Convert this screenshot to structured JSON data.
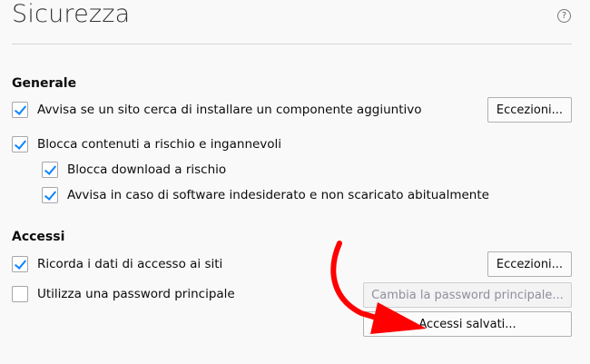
{
  "page": {
    "title": "Sicurezza",
    "help_icon": "?"
  },
  "general": {
    "heading": "Generale",
    "addons_warn_label": "Avvisa se un sito cerca di installare un componente aggiuntivo",
    "exceptions_label": "Eccezioni...",
    "block_dangerous_label": "Blocca contenuti a rischio e ingannevoli",
    "block_downloads_label": "Blocca download a rischio",
    "warn_unwanted_label": "Avvisa in caso di software indesiderato e non scaricato abitualmente"
  },
  "logins": {
    "heading": "Accessi",
    "remember_label": "Ricorda i dati di accesso ai siti",
    "exceptions_label": "Eccezioni...",
    "master_password_label": "Utilizza una password principale",
    "change_master_label": "Cambia la password principale...",
    "saved_logins_label": "Accessi salvati..."
  },
  "colors": {
    "accent": "#0a84ff",
    "annotation_arrow": "#ff0000"
  }
}
